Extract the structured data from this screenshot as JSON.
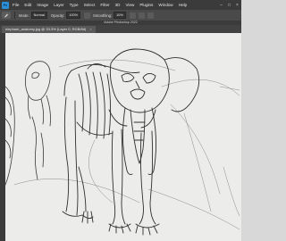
{
  "menubar": {
    "logo": "Ps",
    "items": [
      "File",
      "Edit",
      "Image",
      "Layer",
      "Type",
      "Select",
      "Filter",
      "3D",
      "View",
      "Plugins",
      "Window",
      "Help"
    ]
  },
  "optionsbar": {
    "mode_label": "Mode:",
    "mode_value": "Normal",
    "opacity_label": "Opacity:",
    "opacity_value": "100%",
    "smoothing_label": "Smoothing:",
    "smoothing_value": "10%"
  },
  "app_title": "Adobe Photoshop 2022",
  "document": {
    "tab_label": "elephant_anatomy.jpg @ 33.3% (Layer 0, RGB/8#)",
    "close_glyph": "×"
  },
  "window_controls": [
    "–",
    "□",
    "×"
  ],
  "colors": {
    "chrome_dark": "#3b3b3b",
    "chrome_mid": "#4a4a4a",
    "canvas_bg": "#ececea",
    "sketch_stroke": "#3a3a3a"
  }
}
